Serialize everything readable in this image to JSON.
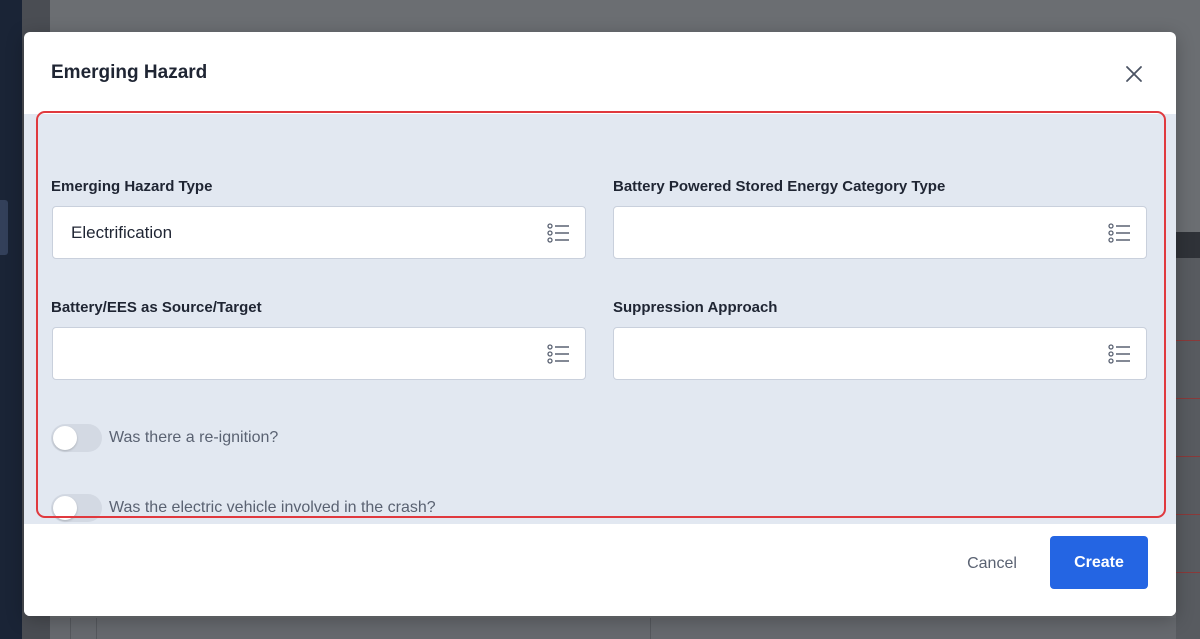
{
  "modal": {
    "title": "Emerging Hazard",
    "close_icon": "close-icon"
  },
  "fields": {
    "emerging_hazard_type": {
      "label": "Emerging Hazard Type",
      "value": "Electrification",
      "icon": "list-icon"
    },
    "battery_category_type": {
      "label": "Battery Powered Stored Energy Category Type",
      "value": "",
      "icon": "list-icon"
    },
    "battery_source_target": {
      "label": "Battery/EES as Source/Target",
      "value": "",
      "icon": "list-icon"
    },
    "suppression_approach": {
      "label": "Suppression Approach",
      "value": "",
      "icon": "list-icon"
    }
  },
  "toggles": {
    "reignition": {
      "label": "Was there a re-ignition?",
      "checked": false
    },
    "ev_involved": {
      "label": "Was the electric vehicle involved in the crash?",
      "checked": false
    }
  },
  "footer": {
    "cancel_label": "Cancel",
    "create_label": "Create"
  },
  "colors": {
    "accent": "#2465e3",
    "highlight": "#e0393e",
    "body_bg": "#e2e8f1"
  }
}
